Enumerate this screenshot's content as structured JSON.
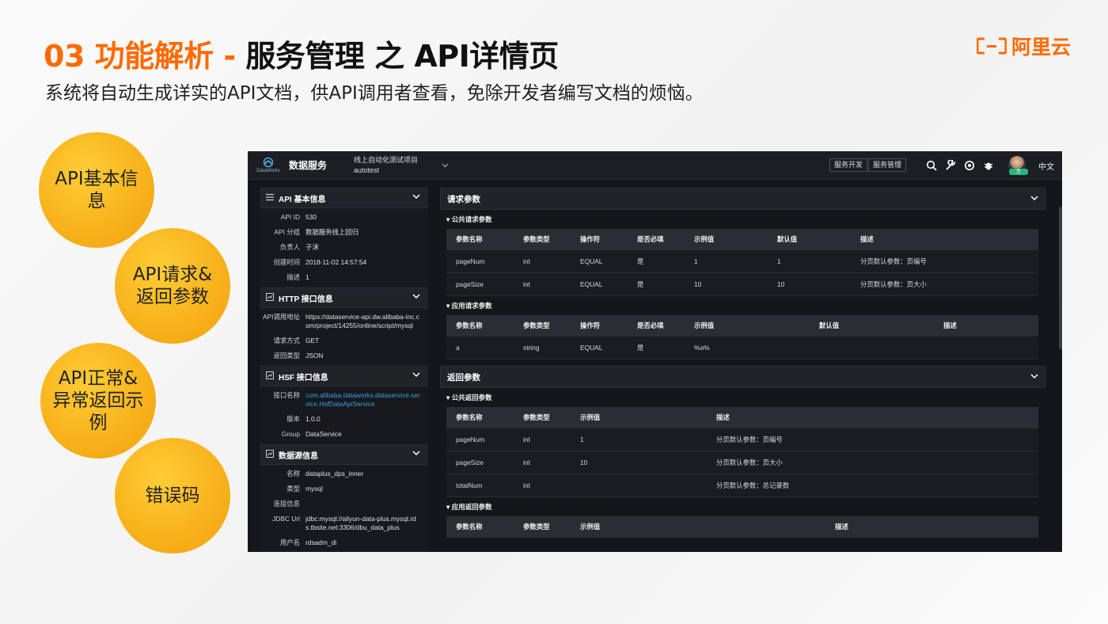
{
  "slide": {
    "title_number": "03",
    "title_orange": "功能解析 -",
    "title_dark": "服务管理 之 API详情页",
    "subtitle": "系统将自动生成详实的API文档，供API调用者查看，免除开发者编写文档的烦恼。",
    "brand": "阿里云"
  },
  "circles": [
    "API基本信息",
    "API请求&返回参数",
    "API正常&异常返回示例",
    "错误码"
  ],
  "app": {
    "logo_text": "DataWorks",
    "name": "数据服务",
    "project_name": "线上自动化测试项目",
    "project_id": "autotest",
    "btn_dev": "服务开发",
    "btn_manage": "服务管理",
    "lang": "中文",
    "avatar_badge": "主",
    "icons": [
      "search-icon",
      "wrench-icon",
      "support-icon",
      "bug-icon"
    ]
  },
  "left": {
    "basic": {
      "title": "API 基本信息",
      "rows": [
        {
          "k": "API ID",
          "v": "530"
        },
        {
          "k": "API 分组",
          "v": "数据服务线上回归"
        },
        {
          "k": "负责人",
          "v": "子洣"
        },
        {
          "k": "创建时间",
          "v": "2018-11-02 14:57:54"
        },
        {
          "k": "描述",
          "v": "1"
        }
      ]
    },
    "http": {
      "title": "HTTP 接口信息",
      "rows": [
        {
          "k": "API调用地址",
          "v": "https://dataservice-api.dw.alibaba-inc.com/project/14255/online/script/mysql"
        },
        {
          "k": "请求方式",
          "v": "GET"
        },
        {
          "k": "返回类型",
          "v": "JSON"
        }
      ]
    },
    "hsf": {
      "title": "HSF 接口信息",
      "rows": [
        {
          "k": "接口名称",
          "v": "com.alibaba.dataworks.dataservice.service.HsfDataApiService"
        },
        {
          "k": "版本",
          "v": "1.0.0"
        },
        {
          "k": "Group",
          "v": "DataService"
        }
      ]
    },
    "datasource": {
      "title": "数据源信息",
      "rows": [
        {
          "k": "名称",
          "v": "dataplus_dps_inner"
        },
        {
          "k": "类型",
          "v": "mysql"
        },
        {
          "k": "连接信息",
          "v": ""
        },
        {
          "k": "JDBC Url",
          "v": "jdbc:mysql://aliyun-data-plus.mysql.rds.tbsite.net:3306/dbu_data_plus"
        },
        {
          "k": "用户名",
          "v": "rdsadm_di"
        }
      ]
    }
  },
  "right": {
    "request": {
      "title": "请求参数",
      "public": {
        "title": "▾ 公共请求参数",
        "headers": [
          "参数名称",
          "参数类型",
          "操作符",
          "是否必填",
          "示例值",
          "默认值",
          "描述"
        ],
        "rows": [
          [
            "pageNum",
            "int",
            "EQUAL",
            "是",
            "1",
            "1",
            "分页默认参数：页编号"
          ],
          [
            "pageSize",
            "int",
            "EQUAL",
            "是",
            "10",
            "10",
            "分页默认参数：页大小"
          ]
        ]
      },
      "app": {
        "title": "▾ 应用请求参数",
        "headers": [
          "参数名称",
          "参数类型",
          "操作符",
          "是否必填",
          "示例值",
          "默认值",
          "描述"
        ],
        "rows": [
          [
            "a",
            "string",
            "EQUAL",
            "是",
            "%a%",
            "",
            ""
          ]
        ]
      }
    },
    "response": {
      "title": "返回参数",
      "public": {
        "title": "▾ 公共返回参数",
        "headers": [
          "参数名称",
          "参数类型",
          "示例值",
          "描述"
        ],
        "rows": [
          [
            "pageNum",
            "int",
            "1",
            "分页默认参数：页编号"
          ],
          [
            "pageSize",
            "int",
            "10",
            "分页默认参数：页大小"
          ],
          [
            "totalNum",
            "int",
            "",
            "分页默认参数：总记录数"
          ]
        ]
      },
      "app": {
        "title": "▾ 应用返回参数",
        "headers": [
          "参数名称",
          "参数类型",
          "示例值",
          "描述"
        ]
      }
    }
  }
}
